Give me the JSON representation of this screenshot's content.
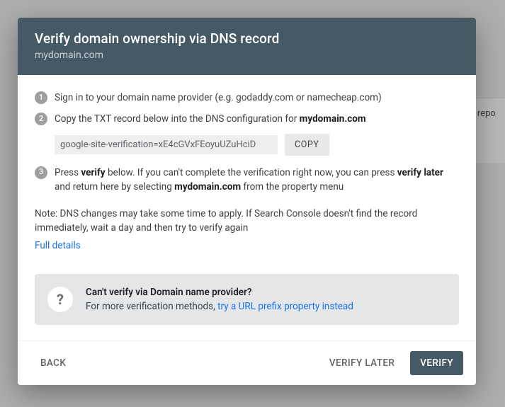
{
  "background": {
    "hint_text": "ur repo"
  },
  "header": {
    "title": "Verify domain ownership via DNS record",
    "subtitle": "mydomain.com"
  },
  "steps": {
    "s1": {
      "num": "1",
      "text": "Sign in to your domain name provider (e.g. godaddy.com or namecheap.com)"
    },
    "s2": {
      "num": "2",
      "pre": "Copy the TXT record below into the DNS configuration for ",
      "domain": "mydomain.com",
      "txt_value": "google-site-verification=xE4cGVxFEoyuUZuHciD",
      "copy_label": "COPY"
    },
    "s3": {
      "num": "3",
      "t1": "Press ",
      "b1": "verify",
      "t2": " below. If you can't complete the verification right now, you can press ",
      "b2": "verify later",
      "t3": " and return here by selecting ",
      "b3": "mydomain.com",
      "t4": " from the property menu"
    }
  },
  "note": "Note: DNS changes may take some time to apply. If Search Console doesn't find the record immediately, wait a day and then try to verify again",
  "details_link": "Full details",
  "alt": {
    "title": "Can't verify via Domain name provider?",
    "pre": "For more verification methods, ",
    "link": "try a URL prefix property instead"
  },
  "footer": {
    "back": "BACK",
    "verify_later": "VERIFY LATER",
    "verify": "VERIFY"
  }
}
